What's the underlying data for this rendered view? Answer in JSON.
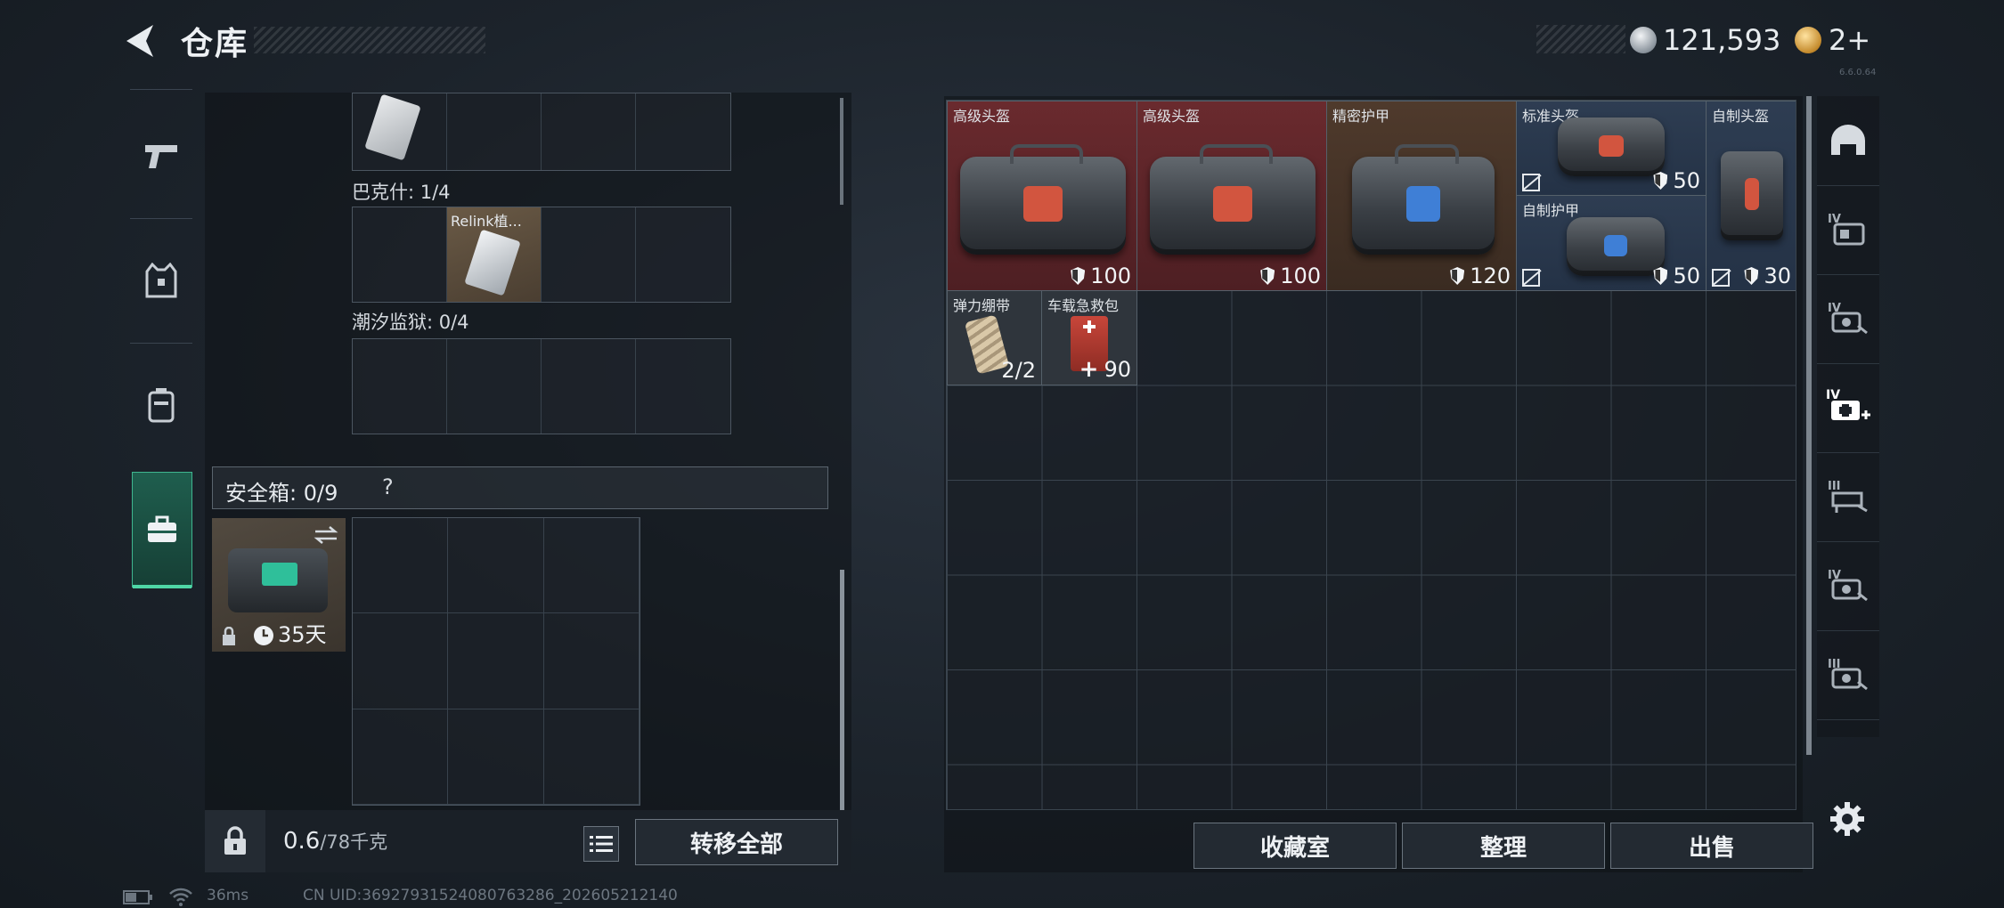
{
  "header": {
    "title": "仓库",
    "silver_amount": "121,593",
    "gold_amount": "2+",
    "version": "6.6.0.64"
  },
  "left_nav": {
    "items": [
      {
        "name": "weapons",
        "icon": "pistol-icon",
        "active": false
      },
      {
        "name": "gear",
        "icon": "vest-icon",
        "active": false
      },
      {
        "name": "backpack",
        "icon": "backpack-icon",
        "active": false
      },
      {
        "name": "secure-container",
        "icon": "briefcase-icon",
        "active": true
      }
    ]
  },
  "key_sections": [
    {
      "label": "巴克什: 1/4",
      "items": [
        {
          "slot": 1,
          "name": "Relink植..."
        }
      ]
    },
    {
      "label": "潮汐监狱: 0/4",
      "items": []
    }
  ],
  "safe_box": {
    "title": "安全箱: 0/9",
    "help": "?",
    "duration": "35天"
  },
  "footer_left": {
    "weight": "0.6",
    "weight_capacity": "/78千克",
    "transfer_all": "转移全部"
  },
  "storage_items": [
    {
      "name": "高级头盔",
      "stat": "100",
      "tint": "red"
    },
    {
      "name": "高级头盔",
      "stat": "100",
      "tint": "red"
    },
    {
      "name": "精密护甲",
      "stat": "120",
      "tint": "brown"
    },
    {
      "name": "标准头盔",
      "stat": "50",
      "tint": "blue",
      "broken": true
    },
    {
      "name": "自制护甲",
      "stat": "50",
      "tint": "blue",
      "broken": true
    },
    {
      "name": "自制头盔",
      "stat": "30",
      "tint": "blue",
      "broken": true
    },
    {
      "name": "弹力绷带",
      "stat": "2/2",
      "tint": "gray"
    },
    {
      "name": "车载急救包",
      "stat": "90",
      "tint": "gray"
    }
  ],
  "footer_right": {
    "collection_room": "收藏室",
    "organize": "整理",
    "sell": "出售"
  },
  "right_rail": {
    "items": [
      {
        "name": "helmet",
        "icon": "helmet-icon"
      },
      {
        "name": "armor-iv",
        "label": "IV",
        "icon": "armor-icon"
      },
      {
        "name": "rig-iv",
        "label": "IV",
        "icon": "rig-icon"
      },
      {
        "name": "medkit-iv",
        "label": "IV",
        "icon": "medkit-plus-icon",
        "active": true
      },
      {
        "name": "rig-iii",
        "label": "III",
        "icon": "rig-icon"
      },
      {
        "name": "rig-iv-2",
        "label": "IV",
        "icon": "rig-icon"
      },
      {
        "name": "rig-iii-2",
        "label": "III",
        "icon": "rig-icon"
      }
    ]
  },
  "status_bar": {
    "latency": "36ms",
    "uid": "CN UID:36927931524080763286_202605212140"
  },
  "colors": {
    "accent_green": "#4fd6a6",
    "tier_red": "#6a2a2e",
    "tier_brown": "#4f3a2c",
    "tier_blue": "#2e3d52"
  }
}
